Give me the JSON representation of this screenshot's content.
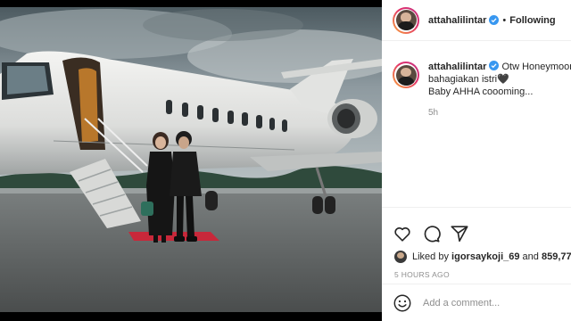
{
  "post": {
    "username": "attahalilintar",
    "follow_status": "Following",
    "separator": "•",
    "caption_lines": [
      "Otw Honeymoon",
      "bahagiakan istri",
      "Baby AHHA coooming..."
    ],
    "caption_heart": "🖤",
    "caption_time": "5h",
    "liked_prefix": "Liked by",
    "liked_user": "igorsaykoji_69",
    "liked_and": "and",
    "likes_count": "859,77",
    "posted_ago": "5 HOURS AGO",
    "comment_placeholder": "Add a comment..."
  },
  "icons": {
    "verified": "verified-badge-icon",
    "like": "heart-icon",
    "comment": "comment-bubble-icon",
    "share": "paper-plane-icon",
    "emoji": "smiley-icon"
  },
  "colors": {
    "verified": "#3897f0",
    "text": "#262626",
    "muted": "#8e8e8e",
    "border": "#efefef",
    "carpet": "#c8283a"
  }
}
